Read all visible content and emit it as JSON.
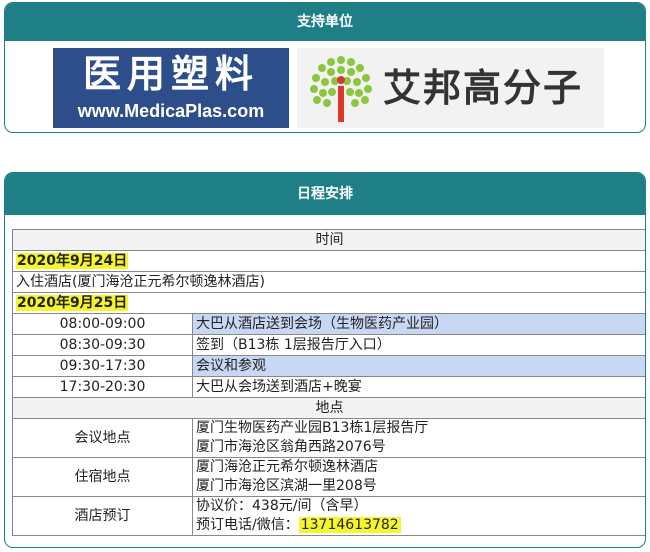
{
  "sponsor": {
    "title": "支持单位",
    "logo_medica_cn": "医用塑料",
    "logo_medica_url": "www.MedicaPlas.com",
    "logo_aibang": "艾邦高分子",
    "colors": {
      "header": "#1f7f86",
      "medica_bg": "#2d4e8a",
      "aibang_green": "#8cc63e",
      "aibang_red": "#d9382a"
    }
  },
  "schedule": {
    "title": "日程安排",
    "time_header": "时间",
    "day1": {
      "date": "2020年9月24日",
      "event": "入住酒店(厦门海沧正元希尔顿逸林酒店)"
    },
    "day2": {
      "date": "2020年9月25日",
      "items": [
        {
          "time": "08:00-09:00",
          "event": "大巴从酒店送到会场（生物医药产业园）"
        },
        {
          "time": "08:30-09:30",
          "event": "签到（B13栋 1层报告厅入口）"
        },
        {
          "time": "09:30-17:30",
          "event": "会议和参观"
        },
        {
          "time": "17:30-20:30",
          "event": "大巴从会场送到酒店+晚宴"
        }
      ]
    },
    "place_header": "地点",
    "venue": {
      "label": "会议地点",
      "line1": "厦门生物医药产业园B13栋1层报告厅",
      "line2": "厦门市海沧区翁角西路2076号"
    },
    "hotel": {
      "label": "住宿地点",
      "line1": "厦门海沧正元希尔顿逸林酒店",
      "line2": "厦门市海沧区滨湖一里208号"
    },
    "booking": {
      "label": "酒店预订",
      "line1": "协议价：438元/间（含早）",
      "line2_prefix": "预订电话/微信：",
      "phone": "13714613782"
    }
  }
}
